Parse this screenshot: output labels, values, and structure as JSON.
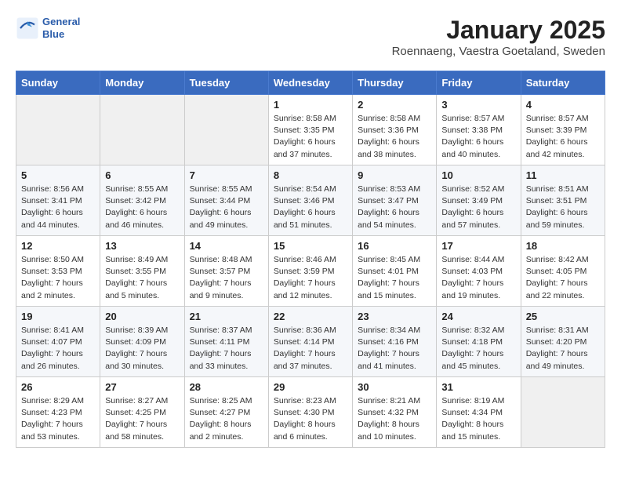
{
  "logo": {
    "line1": "General",
    "line2": "Blue"
  },
  "title": "January 2025",
  "subtitle": "Roennaeng, Vaestra Goetaland, Sweden",
  "weekdays": [
    "Sunday",
    "Monday",
    "Tuesday",
    "Wednesday",
    "Thursday",
    "Friday",
    "Saturday"
  ],
  "weeks": [
    [
      {
        "day": "",
        "info": ""
      },
      {
        "day": "",
        "info": ""
      },
      {
        "day": "",
        "info": ""
      },
      {
        "day": "1",
        "info": "Sunrise: 8:58 AM\nSunset: 3:35 PM\nDaylight: 6 hours\nand 37 minutes."
      },
      {
        "day": "2",
        "info": "Sunrise: 8:58 AM\nSunset: 3:36 PM\nDaylight: 6 hours\nand 38 minutes."
      },
      {
        "day": "3",
        "info": "Sunrise: 8:57 AM\nSunset: 3:38 PM\nDaylight: 6 hours\nand 40 minutes."
      },
      {
        "day": "4",
        "info": "Sunrise: 8:57 AM\nSunset: 3:39 PM\nDaylight: 6 hours\nand 42 minutes."
      }
    ],
    [
      {
        "day": "5",
        "info": "Sunrise: 8:56 AM\nSunset: 3:41 PM\nDaylight: 6 hours\nand 44 minutes."
      },
      {
        "day": "6",
        "info": "Sunrise: 8:55 AM\nSunset: 3:42 PM\nDaylight: 6 hours\nand 46 minutes."
      },
      {
        "day": "7",
        "info": "Sunrise: 8:55 AM\nSunset: 3:44 PM\nDaylight: 6 hours\nand 49 minutes."
      },
      {
        "day": "8",
        "info": "Sunrise: 8:54 AM\nSunset: 3:46 PM\nDaylight: 6 hours\nand 51 minutes."
      },
      {
        "day": "9",
        "info": "Sunrise: 8:53 AM\nSunset: 3:47 PM\nDaylight: 6 hours\nand 54 minutes."
      },
      {
        "day": "10",
        "info": "Sunrise: 8:52 AM\nSunset: 3:49 PM\nDaylight: 6 hours\nand 57 minutes."
      },
      {
        "day": "11",
        "info": "Sunrise: 8:51 AM\nSunset: 3:51 PM\nDaylight: 6 hours\nand 59 minutes."
      }
    ],
    [
      {
        "day": "12",
        "info": "Sunrise: 8:50 AM\nSunset: 3:53 PM\nDaylight: 7 hours\nand 2 minutes."
      },
      {
        "day": "13",
        "info": "Sunrise: 8:49 AM\nSunset: 3:55 PM\nDaylight: 7 hours\nand 5 minutes."
      },
      {
        "day": "14",
        "info": "Sunrise: 8:48 AM\nSunset: 3:57 PM\nDaylight: 7 hours\nand 9 minutes."
      },
      {
        "day": "15",
        "info": "Sunrise: 8:46 AM\nSunset: 3:59 PM\nDaylight: 7 hours\nand 12 minutes."
      },
      {
        "day": "16",
        "info": "Sunrise: 8:45 AM\nSunset: 4:01 PM\nDaylight: 7 hours\nand 15 minutes."
      },
      {
        "day": "17",
        "info": "Sunrise: 8:44 AM\nSunset: 4:03 PM\nDaylight: 7 hours\nand 19 minutes."
      },
      {
        "day": "18",
        "info": "Sunrise: 8:42 AM\nSunset: 4:05 PM\nDaylight: 7 hours\nand 22 minutes."
      }
    ],
    [
      {
        "day": "19",
        "info": "Sunrise: 8:41 AM\nSunset: 4:07 PM\nDaylight: 7 hours\nand 26 minutes."
      },
      {
        "day": "20",
        "info": "Sunrise: 8:39 AM\nSunset: 4:09 PM\nDaylight: 7 hours\nand 30 minutes."
      },
      {
        "day": "21",
        "info": "Sunrise: 8:37 AM\nSunset: 4:11 PM\nDaylight: 7 hours\nand 33 minutes."
      },
      {
        "day": "22",
        "info": "Sunrise: 8:36 AM\nSunset: 4:14 PM\nDaylight: 7 hours\nand 37 minutes."
      },
      {
        "day": "23",
        "info": "Sunrise: 8:34 AM\nSunset: 4:16 PM\nDaylight: 7 hours\nand 41 minutes."
      },
      {
        "day": "24",
        "info": "Sunrise: 8:32 AM\nSunset: 4:18 PM\nDaylight: 7 hours\nand 45 minutes."
      },
      {
        "day": "25",
        "info": "Sunrise: 8:31 AM\nSunset: 4:20 PM\nDaylight: 7 hours\nand 49 minutes."
      }
    ],
    [
      {
        "day": "26",
        "info": "Sunrise: 8:29 AM\nSunset: 4:23 PM\nDaylight: 7 hours\nand 53 minutes."
      },
      {
        "day": "27",
        "info": "Sunrise: 8:27 AM\nSunset: 4:25 PM\nDaylight: 7 hours\nand 58 minutes."
      },
      {
        "day": "28",
        "info": "Sunrise: 8:25 AM\nSunset: 4:27 PM\nDaylight: 8 hours\nand 2 minutes."
      },
      {
        "day": "29",
        "info": "Sunrise: 8:23 AM\nSunset: 4:30 PM\nDaylight: 8 hours\nand 6 minutes."
      },
      {
        "day": "30",
        "info": "Sunrise: 8:21 AM\nSunset: 4:32 PM\nDaylight: 8 hours\nand 10 minutes."
      },
      {
        "day": "31",
        "info": "Sunrise: 8:19 AM\nSunset: 4:34 PM\nDaylight: 8 hours\nand 15 minutes."
      },
      {
        "day": "",
        "info": ""
      }
    ]
  ]
}
